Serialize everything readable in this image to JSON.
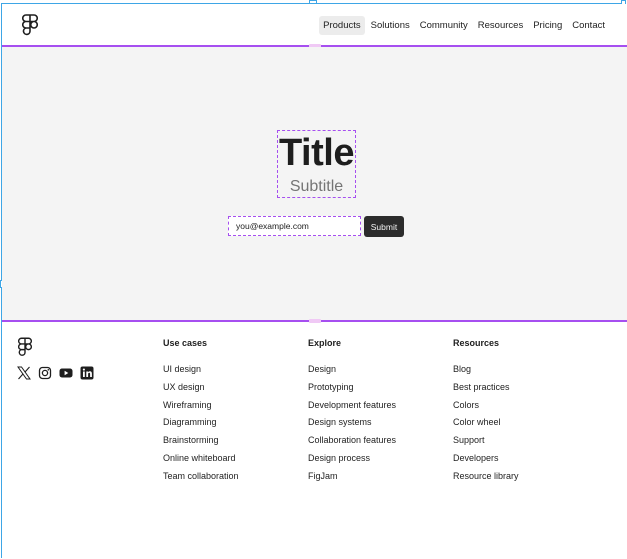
{
  "header": {
    "logo_icon": "figma-logo-icon",
    "nav": [
      "Products",
      "Solutions",
      "Community",
      "Resources",
      "Pricing",
      "Contact"
    ],
    "active_nav": "Products"
  },
  "hero": {
    "title": "Title",
    "subtitle": "Subtitle",
    "email_value": "you@example.com",
    "submit_label": "Submit"
  },
  "footer": {
    "logo_icon": "figma-logo-icon",
    "social_icons": [
      "x-icon",
      "instagram-icon",
      "youtube-icon",
      "linkedin-icon"
    ],
    "columns": [
      {
        "title": "Use cases",
        "links": [
          "UI design",
          "UX design",
          "Wireframing",
          "Diagramming",
          "Brainstorming",
          "Online whiteboard",
          "Team collaboration"
        ]
      },
      {
        "title": "Explore",
        "links": [
          "Design",
          "Prototyping",
          "Development features",
          "Design systems",
          "Collaboration features",
          "Design process",
          "FigJam"
        ]
      },
      {
        "title": "Resources",
        "links": [
          "Blog",
          "Best practices",
          "Colors",
          "Color wheel",
          "Support",
          "Developers",
          "Resource library"
        ]
      }
    ]
  },
  "colors": {
    "selection": "#a64ff0",
    "frame": "#3ea6e6",
    "hero_bg": "#f4f4f4",
    "button_bg": "#2c2c2c"
  }
}
